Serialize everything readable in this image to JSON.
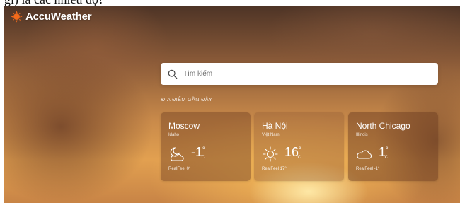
{
  "header_fragment": "gì) là các nhiều độ?",
  "brand": {
    "name": "AccuWeather",
    "color": "#f26a1b"
  },
  "search": {
    "placeholder": "Tìm kiếm"
  },
  "recent": {
    "section_label": "ĐỊA ĐIỂM GẦN ĐÂY",
    "locations": [
      {
        "city": "Moscow",
        "region": "Idaho",
        "icon": "partly-cloudy-night-icon",
        "temp": "-1",
        "degree": "°",
        "unit": "C",
        "realfeel": "RealFeel 0°"
      },
      {
        "city": "Hà Nội",
        "region": "Việt Nam",
        "icon": "sun-icon",
        "temp": "16",
        "degree": "°",
        "unit": "C",
        "realfeel": "RealFeel 17°"
      },
      {
        "city": "North Chicago",
        "region": "Illinois",
        "icon": "cloud-icon",
        "temp": "1",
        "degree": "°",
        "unit": "C",
        "realfeel": "RealFeel -1°"
      }
    ]
  }
}
